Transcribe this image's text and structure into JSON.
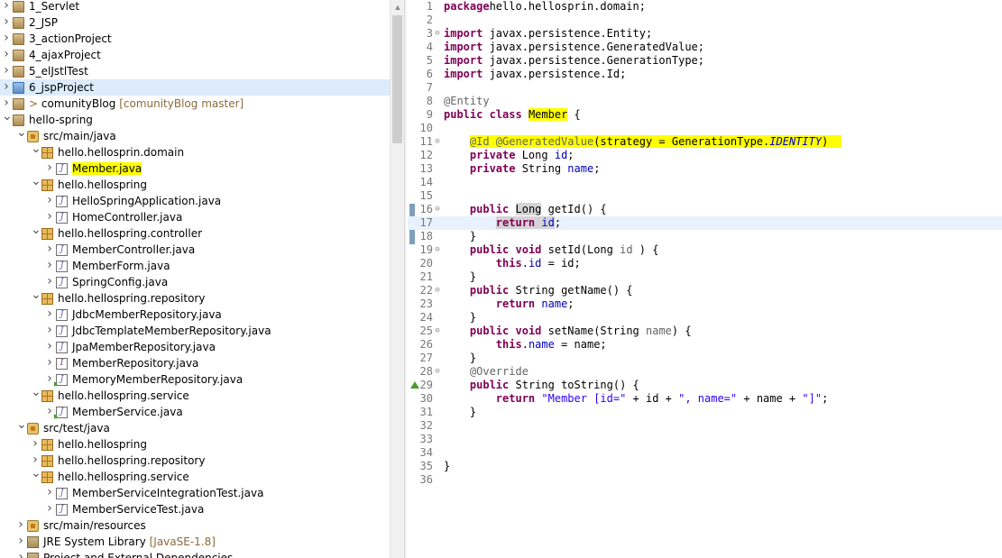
{
  "explorer": {
    "rows": [
      {
        "depth": 0,
        "arrow": ">",
        "icon": "project",
        "label": "1_Servlet"
      },
      {
        "depth": 0,
        "arrow": ">",
        "icon": "project",
        "label": "2_JSP"
      },
      {
        "depth": 0,
        "arrow": ">",
        "icon": "project",
        "label": "3_actionProject"
      },
      {
        "depth": 0,
        "arrow": ">",
        "icon": "project",
        "label": "4_ajaxProject"
      },
      {
        "depth": 0,
        "arrow": ">",
        "icon": "project",
        "label": "5_elJstlTest"
      },
      {
        "depth": 0,
        "arrow": ">",
        "icon": "project-blue",
        "label": "6_jspProject",
        "selected": true
      },
      {
        "depth": 0,
        "arrow": ">",
        "icon": "project",
        "prefix": "> ",
        "label": "comunityBlog",
        "decoration": "[comunityBlog master]"
      },
      {
        "depth": 0,
        "arrow": "v",
        "icon": "project",
        "label": "hello-spring"
      },
      {
        "depth": 1,
        "arrow": "v",
        "icon": "srcfolder",
        "label": "src/main/java"
      },
      {
        "depth": 2,
        "arrow": "v",
        "icon": "package",
        "label": "hello.hellosprin.domain"
      },
      {
        "depth": 3,
        "arrow": ">",
        "icon": "java",
        "label": "Member.java",
        "highlight": true
      },
      {
        "depth": 2,
        "arrow": "v",
        "icon": "package",
        "label": "hello.hellospring"
      },
      {
        "depth": 3,
        "arrow": ">",
        "icon": "java",
        "label": "HelloSpringApplication.java"
      },
      {
        "depth": 3,
        "arrow": ">",
        "icon": "java",
        "label": "HomeController.java"
      },
      {
        "depth": 2,
        "arrow": "v",
        "icon": "package",
        "label": "hello.hellospring.controller"
      },
      {
        "depth": 3,
        "arrow": ">",
        "icon": "java",
        "label": "MemberController.java"
      },
      {
        "depth": 3,
        "arrow": ">",
        "icon": "java",
        "label": "MemberForm.java"
      },
      {
        "depth": 3,
        "arrow": ">",
        "icon": "java",
        "label": "SpringConfig.java"
      },
      {
        "depth": 2,
        "arrow": "v",
        "icon": "package",
        "label": "hello.hellospring.repository"
      },
      {
        "depth": 3,
        "arrow": ">",
        "icon": "java",
        "label": "JdbcMemberRepository.java"
      },
      {
        "depth": 3,
        "arrow": ">",
        "icon": "java",
        "label": "JdbcTemplateMemberRepository.java"
      },
      {
        "depth": 3,
        "arrow": ">",
        "icon": "java",
        "label": "JpaMemberRepository.java"
      },
      {
        "depth": 3,
        "arrow": ">",
        "icon": "java-interface",
        "label": "MemberRepository.java"
      },
      {
        "depth": 3,
        "arrow": ">",
        "icon": "java-run",
        "label": "MemoryMemberRepository.java"
      },
      {
        "depth": 2,
        "arrow": "v",
        "icon": "package",
        "label": "hello.hellospring.service"
      },
      {
        "depth": 3,
        "arrow": ">",
        "icon": "java-run",
        "label": "MemberService.java"
      },
      {
        "depth": 1,
        "arrow": "v",
        "icon": "srcfolder",
        "label": "src/test/java"
      },
      {
        "depth": 2,
        "arrow": ">",
        "icon": "package",
        "label": "hello.hellospring"
      },
      {
        "depth": 2,
        "arrow": ">",
        "icon": "package",
        "label": "hello.hellospring.repository"
      },
      {
        "depth": 2,
        "arrow": "v",
        "icon": "package",
        "label": "hello.hellospring.service"
      },
      {
        "depth": 3,
        "arrow": ">",
        "icon": "java",
        "label": "MemberServiceIntegrationTest.java"
      },
      {
        "depth": 3,
        "arrow": ">",
        "icon": "java",
        "label": "MemberServiceTest.java"
      },
      {
        "depth": 1,
        "arrow": ">",
        "icon": "srcfolder",
        "label": "src/main/resources"
      },
      {
        "depth": 1,
        "arrow": ">",
        "icon": "lib",
        "label": "JRE System Library",
        "decoration": "[JavaSE-1.8]"
      },
      {
        "depth": 1,
        "arrow": ">",
        "icon": "lib",
        "label": "Project and External Dependencies"
      }
    ]
  },
  "editor": {
    "current_line": 17,
    "lines": [
      {
        "n": 1,
        "tokens": [
          [
            "kw",
            "package"
          ],
          [
            "",
            "hello.hellosprin.domain;"
          ]
        ]
      },
      {
        "n": 2,
        "tokens": []
      },
      {
        "n": 3,
        "fold": "⊖",
        "tokens": [
          [
            "kw",
            "import"
          ],
          [
            "",
            " javax.persistence.Entity;"
          ]
        ]
      },
      {
        "n": 4,
        "tokens": [
          [
            "kw",
            "import"
          ],
          [
            "",
            " javax.persistence.GeneratedValue;"
          ]
        ]
      },
      {
        "n": 5,
        "tokens": [
          [
            "kw",
            "import"
          ],
          [
            "",
            " javax.persistence.GenerationType;"
          ]
        ]
      },
      {
        "n": 6,
        "tokens": [
          [
            "kw",
            "import"
          ],
          [
            "",
            " javax.persistence.Id;"
          ]
        ]
      },
      {
        "n": 7,
        "tokens": []
      },
      {
        "n": 8,
        "tokens": [
          [
            "ann",
            "@Entity"
          ]
        ]
      },
      {
        "n": 9,
        "tokens": [
          [
            "kw",
            "public"
          ],
          [
            "",
            " "
          ],
          [
            "kw",
            "class"
          ],
          [
            "",
            " "
          ],
          [
            "yel",
            "Member"
          ],
          [
            "",
            " {"
          ]
        ]
      },
      {
        "n": 10,
        "tokens": []
      },
      {
        "n": 11,
        "fold": "⊖",
        "tokens": [
          [
            "",
            "    "
          ],
          [
            "yel ann",
            "@Id @GeneratedValue"
          ],
          [
            "yel",
            "(strategy = GenerationType."
          ],
          [
            "yel fld ital kw2",
            "IDENTITY"
          ],
          [
            "yel",
            ")  "
          ]
        ]
      },
      {
        "n": 12,
        "tokens": [
          [
            "",
            "    "
          ],
          [
            "kw",
            "private"
          ],
          [
            "",
            " Long "
          ],
          [
            "fld",
            "id"
          ],
          [
            "",
            ";"
          ]
        ]
      },
      {
        "n": 13,
        "tokens": [
          [
            "",
            "    "
          ],
          [
            "kw",
            "private"
          ],
          [
            "",
            " String "
          ],
          [
            "fld",
            "name"
          ],
          [
            "",
            ";"
          ]
        ]
      },
      {
        "n": 14,
        "tokens": []
      },
      {
        "n": 15,
        "tokens": []
      },
      {
        "n": 16,
        "fold": "⊖",
        "tokens": [
          [
            "",
            "    "
          ],
          [
            "kw",
            "public"
          ],
          [
            "",
            " "
          ],
          [
            "occ",
            "Long"
          ],
          [
            "",
            " getId() {"
          ]
        ]
      },
      {
        "n": 17,
        "tokens": [
          [
            "",
            "        "
          ],
          [
            "kw occ",
            "return"
          ],
          [
            "occ",
            " "
          ],
          [
            "fld occ",
            "id"
          ],
          [
            "",
            ";"
          ]
        ]
      },
      {
        "n": 18,
        "tokens": [
          [
            "",
            "    }"
          ]
        ]
      },
      {
        "n": 19,
        "fold": "⊖",
        "tokens": [
          [
            "",
            "    "
          ],
          [
            "kw",
            "public"
          ],
          [
            "",
            " "
          ],
          [
            "kw",
            "void"
          ],
          [
            "",
            " setId(Long "
          ],
          [
            "ann",
            "id"
          ],
          [
            "",
            " ) {"
          ]
        ]
      },
      {
        "n": 20,
        "tokens": [
          [
            "",
            "        "
          ],
          [
            "kw",
            "this"
          ],
          [
            "",
            "."
          ],
          [
            "fld",
            "id"
          ],
          [
            "",
            " = "
          ],
          [
            "",
            "id;"
          ]
        ]
      },
      {
        "n": 21,
        "tokens": [
          [
            "",
            "    }"
          ]
        ]
      },
      {
        "n": 22,
        "fold": "⊖",
        "tokens": [
          [
            "",
            "    "
          ],
          [
            "kw",
            "public"
          ],
          [
            "",
            " String getName() {"
          ]
        ]
      },
      {
        "n": 23,
        "tokens": [
          [
            "",
            "        "
          ],
          [
            "kw",
            "return"
          ],
          [
            "",
            " "
          ],
          [
            "fld",
            "name"
          ],
          [
            "",
            ";"
          ]
        ]
      },
      {
        "n": 24,
        "tokens": [
          [
            "",
            "    }"
          ]
        ]
      },
      {
        "n": 25,
        "fold": "⊖",
        "tokens": [
          [
            "",
            "    "
          ],
          [
            "kw",
            "public"
          ],
          [
            "",
            " "
          ],
          [
            "kw",
            "void"
          ],
          [
            "",
            " setName(String "
          ],
          [
            "ann",
            "name"
          ],
          [
            "",
            ") {"
          ]
        ]
      },
      {
        "n": 26,
        "tokens": [
          [
            "",
            "        "
          ],
          [
            "kw",
            "this"
          ],
          [
            "",
            "."
          ],
          [
            "fld",
            "name"
          ],
          [
            "",
            " = "
          ],
          [
            "",
            "name;"
          ]
        ]
      },
      {
        "n": 27,
        "tokens": [
          [
            "",
            "    }"
          ]
        ]
      },
      {
        "n": 28,
        "fold": "⊖",
        "tokens": [
          [
            "",
            "    "
          ],
          [
            "ann",
            "@Override"
          ]
        ]
      },
      {
        "n": 29,
        "override": true,
        "tokens": [
          [
            "",
            "    "
          ],
          [
            "kw",
            "public"
          ],
          [
            "",
            " String toString() {"
          ]
        ]
      },
      {
        "n": 30,
        "tokens": [
          [
            "",
            "        "
          ],
          [
            "kw",
            "return"
          ],
          [
            "",
            " "
          ],
          [
            "str",
            "\"Member [id=\""
          ],
          [
            "",
            " + id + "
          ],
          [
            "str",
            "\", name=\""
          ],
          [
            "",
            " + name + "
          ],
          [
            "str",
            "\"]\""
          ],
          [
            "",
            ";"
          ]
        ]
      },
      {
        "n": 31,
        "tokens": [
          [
            "",
            "    }"
          ]
        ]
      },
      {
        "n": 32,
        "tokens": []
      },
      {
        "n": 33,
        "tokens": []
      },
      {
        "n": 34,
        "tokens": []
      },
      {
        "n": 35,
        "tokens": [
          [
            "",
            "}"
          ]
        ]
      },
      {
        "n": 36,
        "tokens": []
      }
    ]
  }
}
